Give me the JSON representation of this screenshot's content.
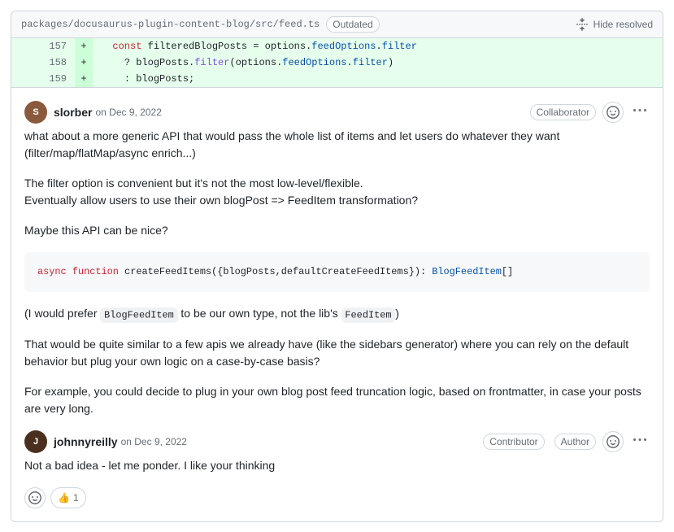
{
  "file_header": {
    "path": "packages/docusaurus-plugin-content-blog/src/feed.ts",
    "badge": "Outdated",
    "hide_resolved": "Hide resolved"
  },
  "diff": {
    "lines": [
      {
        "no": "157",
        "mark": "+",
        "indent": "  ",
        "kw": "const",
        "rest1": " filteredBlogPosts = options.",
        "p1": "feedOptions",
        "dot1": ".",
        "p2": "filter",
        "rest2": ""
      },
      {
        "no": "158",
        "mark": "+",
        "indent": "    ",
        "kw": "",
        "rest1": "? blogPosts.",
        "p1": "",
        "fn": "filter",
        "rest2": "(options.",
        "p2": "feedOptions",
        "dot2": ".",
        "p3": "filter",
        "rest3": ")"
      },
      {
        "no": "159",
        "mark": "+",
        "indent": "    ",
        "kw": "",
        "rest1": ": blogPosts;",
        "p1": "",
        "p2": "",
        "rest2": ""
      }
    ]
  },
  "comments": [
    {
      "author": "slorber",
      "avatar_bg": "#8b5a3c",
      "avatar_initial": "S",
      "date_prefix": "on ",
      "date": "Dec 9, 2022",
      "roles": [
        "Collaborator"
      ],
      "reactions": [],
      "body": {
        "p1": "what about a more generic API that would pass the whole list of items and let users do whatever they want (filter/map/flatMap/async enrich...)",
        "p2a": "The filter option is convenient but it's not the most low-level/flexible.",
        "p2b": "Eventually allow users to use their own blogPost => FeedItem transformation?",
        "p3": "Maybe this API can be nice?",
        "snippet": {
          "kw1": "async",
          "kw2": "function",
          "fn": " createFeedItems({blogPosts,defaultCreateFeedItems}): ",
          "type": "BlogFeedItem",
          "suffix": "[]"
        },
        "p4_pre": "(I would prefer ",
        "p4_code1": "BlogFeedItem",
        "p4_mid": " to be our own type, not the lib's ",
        "p4_code2": "FeedItem",
        "p4_post": ")",
        "p5": "That would be quite similar to a few apis we already have (like the sidebars generator) where you can rely on the default behavior but plug your own logic on a case-by-case basis?",
        "p6": "For example, you could decide to plug in your own blog post feed truncation logic, based on frontmatter, in case your posts are very long."
      }
    },
    {
      "author": "johnnyreilly",
      "avatar_bg": "#4a2f1f",
      "avatar_initial": "J",
      "date_prefix": "on ",
      "date": "Dec 9, 2022",
      "roles": [
        "Contributor",
        "Author"
      ],
      "reactions": [
        {
          "emoji": "👍",
          "count": "1"
        }
      ],
      "body": {
        "p1": "Not a bad idea - let me ponder. I like your thinking"
      }
    }
  ]
}
